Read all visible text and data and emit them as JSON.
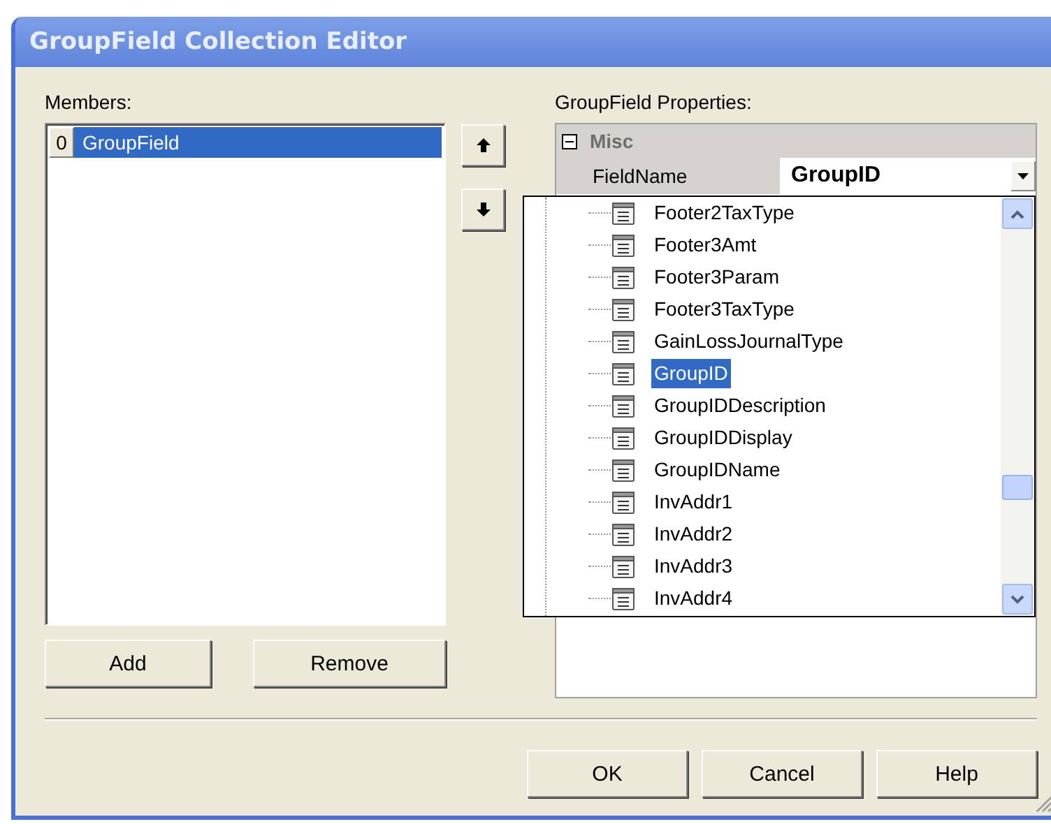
{
  "window": {
    "title": "GroupField Collection Editor"
  },
  "members": {
    "label": "Members:",
    "items": [
      {
        "index": "0",
        "name": "GroupField",
        "selected": true
      }
    ]
  },
  "member_buttons": [
    "Add",
    "Remove"
  ],
  "properties": {
    "label": "GroupField Properties:",
    "category": {
      "name": "Misc",
      "expanded": true
    },
    "rows": [
      {
        "name": "FieldName",
        "value": "GroupID",
        "open": true
      }
    ]
  },
  "dropdown": {
    "items": [
      {
        "label": "Footer2TaxType",
        "selected": false
      },
      {
        "label": "Footer3Amt",
        "selected": false
      },
      {
        "label": "Footer3Param",
        "selected": false
      },
      {
        "label": "Footer3TaxType",
        "selected": false
      },
      {
        "label": "GainLossJournalType",
        "selected": false
      },
      {
        "label": "GroupID",
        "selected": true
      },
      {
        "label": "GroupIDDescription",
        "selected": false
      },
      {
        "label": "GroupIDDisplay",
        "selected": false
      },
      {
        "label": "GroupIDName",
        "selected": false
      },
      {
        "label": "InvAddr1",
        "selected": false
      },
      {
        "label": "InvAddr2",
        "selected": false
      },
      {
        "label": "InvAddr3",
        "selected": false
      },
      {
        "label": "InvAddr4",
        "selected": false
      }
    ]
  },
  "dialog_buttons": [
    "OK",
    "Cancel",
    "Help"
  ]
}
